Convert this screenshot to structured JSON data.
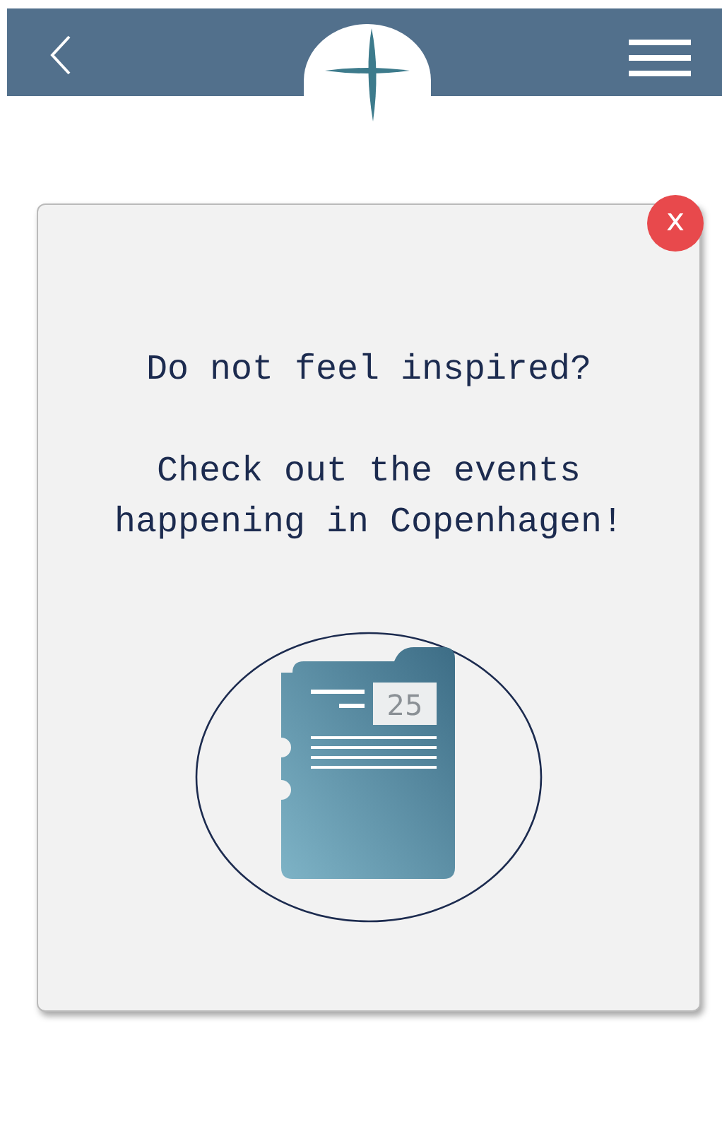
{
  "popup": {
    "close": "x",
    "headline": "Do not feel inspired?",
    "message": "Check out the events happening in Copenhagen!",
    "calendar_day": "25"
  }
}
